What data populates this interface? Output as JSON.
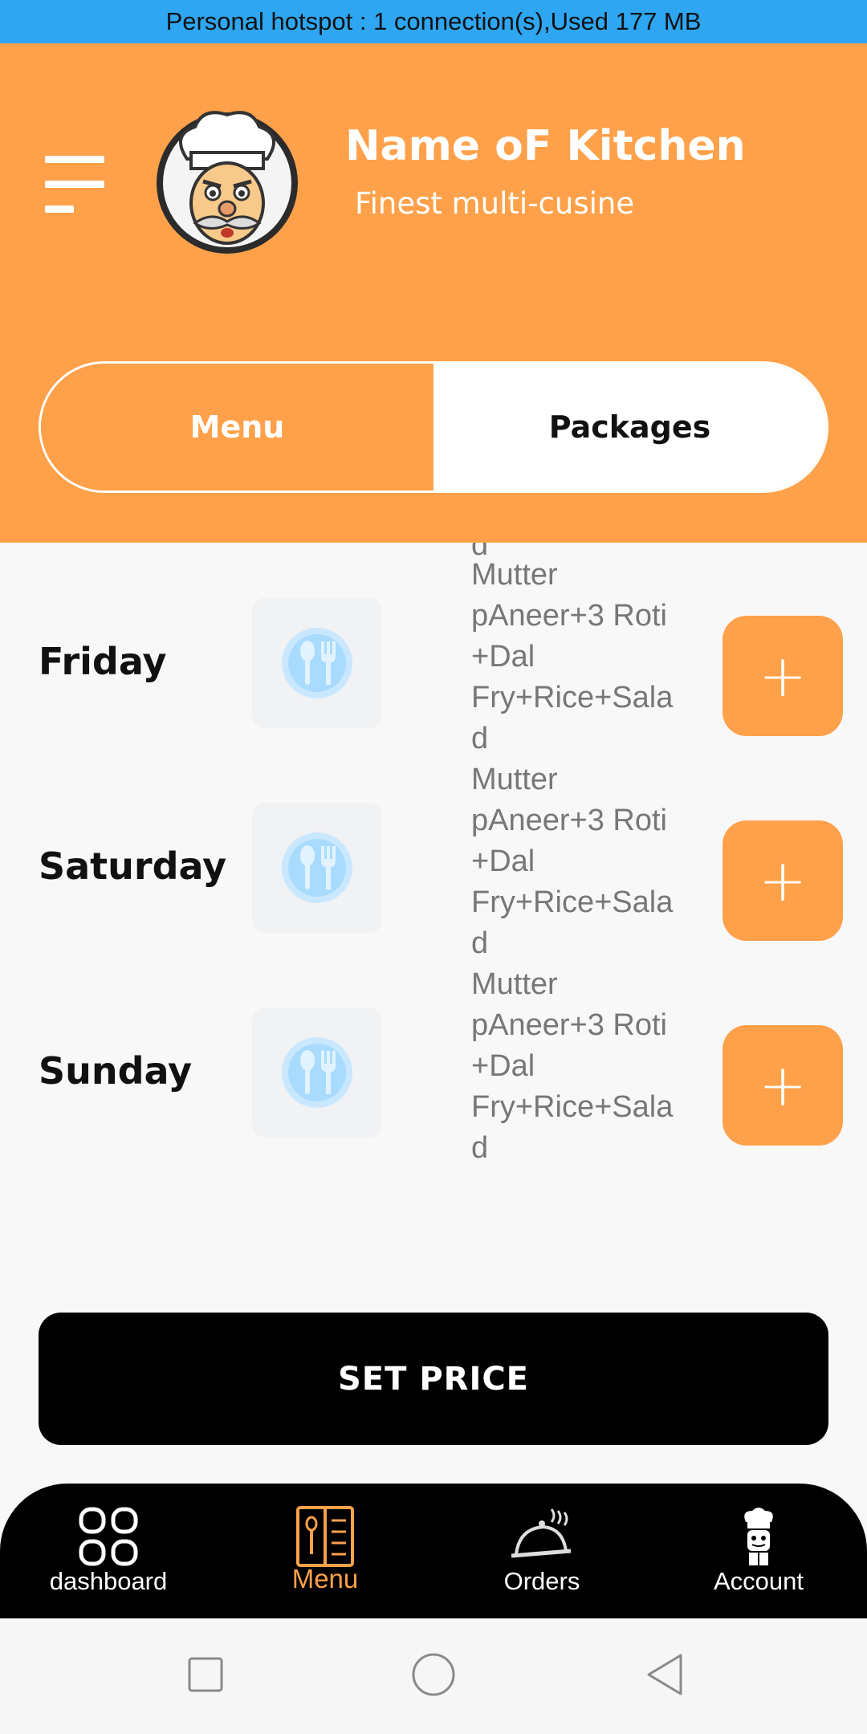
{
  "status_bar": {
    "text": "Personal hotspot : 1 connection(s),Used  177 MB"
  },
  "header": {
    "menu_icon": "hamburger-icon",
    "logo_icon": "chef-logo",
    "kitchen_name": "Name oF Kitchen",
    "tagline": "Finest multi-cusine",
    "brand_color": "#ffa14a"
  },
  "tabs": {
    "menu": "Menu",
    "packages": "Packages",
    "selected": "Menu"
  },
  "list": {
    "partial_top_text": "d",
    "rows": [
      {
        "day": "Friday",
        "lines": [
          "Mutter",
          "pAneer+3 Roti",
          "+Dal",
          "Fry+Rice+Sala",
          "d"
        ],
        "add": "+"
      },
      {
        "day": "Saturday",
        "lines": [
          "Mutter",
          "pAneer+3 Roti",
          "+Dal",
          "Fry+Rice+Sala",
          "d"
        ],
        "add": "+"
      },
      {
        "day": "Sunday",
        "lines": [
          "Mutter",
          "pAneer+3 Roti",
          "+Dal",
          "Fry+Rice+Sala",
          "d"
        ],
        "add": "+"
      }
    ]
  },
  "set_price_label": "SET PRICE",
  "bottom_nav": [
    {
      "label": "dashboard",
      "icon": "grid-icon"
    },
    {
      "label": "Menu",
      "icon": "menu-book-icon",
      "active": true
    },
    {
      "label": "Orders",
      "icon": "cloche-icon"
    },
    {
      "label": "Account",
      "icon": "chef-icon"
    }
  ],
  "system_nav": [
    "square-icon",
    "circle-icon",
    "back-triangle-icon"
  ]
}
